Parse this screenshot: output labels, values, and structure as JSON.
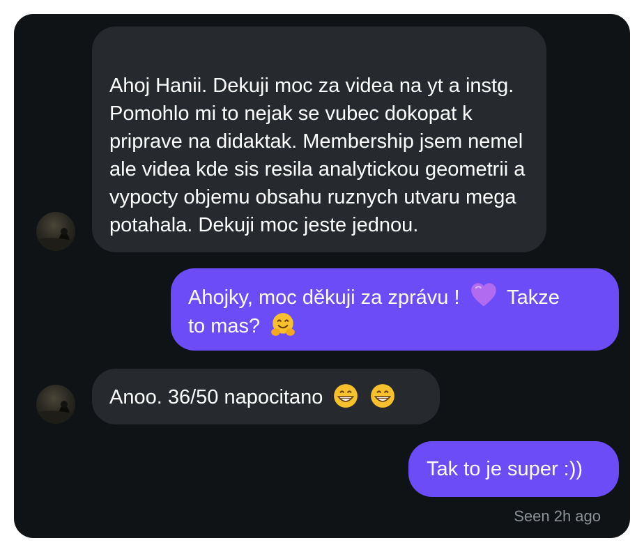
{
  "thread": {
    "messages": [
      {
        "sender": "them",
        "text": "Ahoj Hanii. Dekuji moc za videa na yt a instg. Pomohlo mi to nejak se vubec dokopat k priprave na didaktak. Membership jsem nemel ale videa kde sis resila analytickou geometrii a vypocty objemu obsahu ruznych utvaru mega potahala. Dekuji moc jeste jednou."
      },
      {
        "sender": "me",
        "text_before_heart": "Ahojky, moc děkuji za zprávu !",
        "text_after_heart": "Takze",
        "text_line2": "to mas?",
        "emoji": [
          "purple-heart",
          "hugging-face"
        ]
      },
      {
        "sender": "them",
        "text": "Anoo. 36/50 napocitano",
        "emoji": [
          "grinning-face",
          "grinning-face"
        ]
      },
      {
        "sender": "me",
        "text": "Tak to je super :))"
      }
    ],
    "status": "Seen 2h ago"
  },
  "colors": {
    "background": "#0f1316",
    "incoming_bubble": "#262a2f",
    "outgoing_bubble": "#6b4cf6",
    "status_text": "#8d9298"
  }
}
